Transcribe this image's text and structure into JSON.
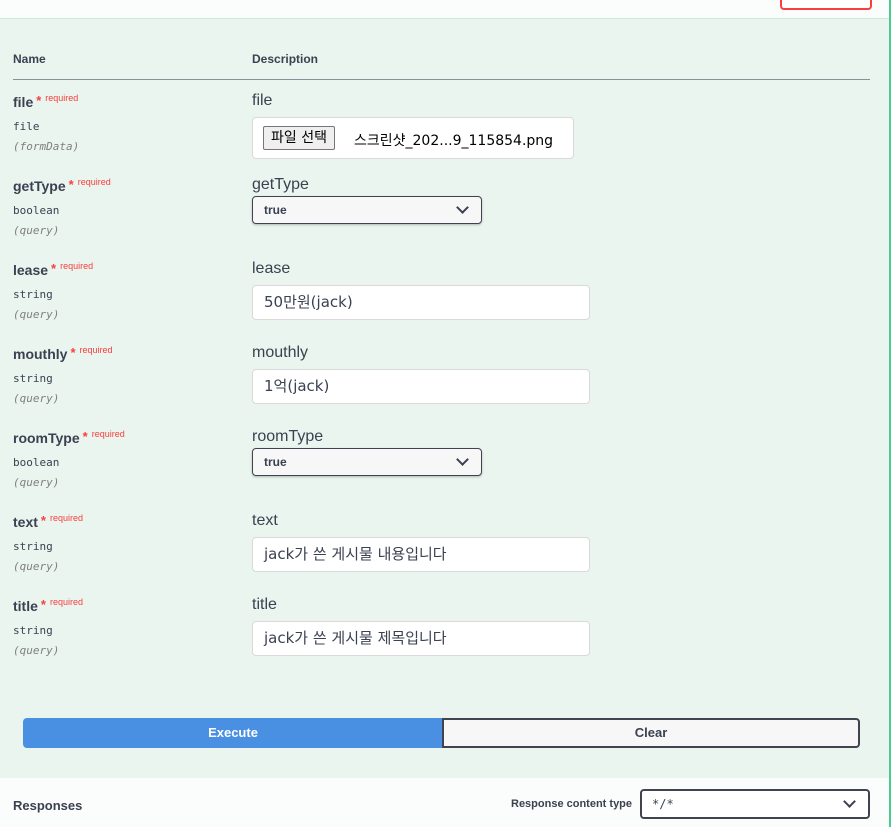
{
  "table": {
    "header_name": "Name",
    "header_description": "Description"
  },
  "required_star": "*",
  "required_label": "required",
  "params": {
    "file": {
      "name": "file",
      "type": "file",
      "in": "(formData)",
      "desc": "file",
      "button": "파일 선택",
      "filename": "스크린샷_202...9_115854.png"
    },
    "getType": {
      "name": "getType",
      "type": "boolean",
      "in": "(query)",
      "desc": "getType",
      "value": "true"
    },
    "lease": {
      "name": "lease",
      "type": "string",
      "in": "(query)",
      "desc": "lease",
      "value": "50만원(jack)"
    },
    "mouthly": {
      "name": "mouthly",
      "type": "string",
      "in": "(query)",
      "desc": "mouthly",
      "value": "1억(jack)"
    },
    "roomType": {
      "name": "roomType",
      "type": "boolean",
      "in": "(query)",
      "desc": "roomType",
      "value": "true"
    },
    "text": {
      "name": "text",
      "type": "string",
      "in": "(query)",
      "desc": "text",
      "value": "jack가 쓴 게시물 내용입니다"
    },
    "title": {
      "name": "title",
      "type": "string",
      "in": "(query)",
      "desc": "title",
      "value": "jack가 쓴 게시물 제목입니다"
    }
  },
  "actions": {
    "execute": "Execute",
    "clear": "Clear"
  },
  "responses": {
    "title": "Responses",
    "content_type_label": "Response content type",
    "content_type_value": "*/*"
  },
  "colors": {
    "background": "#e9f5ee",
    "required": "#f93e3e",
    "execute": "#4990e2",
    "border": "#41444e"
  },
  "icons": [
    "chevron-down-icon"
  ]
}
